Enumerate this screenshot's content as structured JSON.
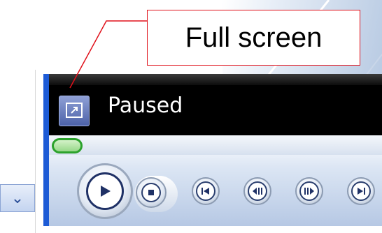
{
  "callout": {
    "text": "Full screen"
  },
  "player": {
    "status": "Paused",
    "fullscreen_button": {
      "icon": "fullscreen-icon"
    },
    "seek": {
      "position": 0.0
    },
    "controls": {
      "play": {
        "icon": "play-icon"
      },
      "stop": {
        "icon": "stop-icon"
      },
      "previous": {
        "icon": "skip-back-icon"
      },
      "rewind": {
        "icon": "rewind-icon"
      },
      "forward": {
        "icon": "fast-forward-icon"
      },
      "next": {
        "icon": "skip-forward-icon"
      }
    }
  },
  "left_panel": {
    "dropdown_icon": "chevron-down-icon"
  },
  "colors": {
    "callout_border": "#e0101a",
    "player_bg": "#000000",
    "status_text": "#ffffff",
    "seek_thumb": "#2ca22c",
    "accent_blue": "#1d5bd6"
  }
}
